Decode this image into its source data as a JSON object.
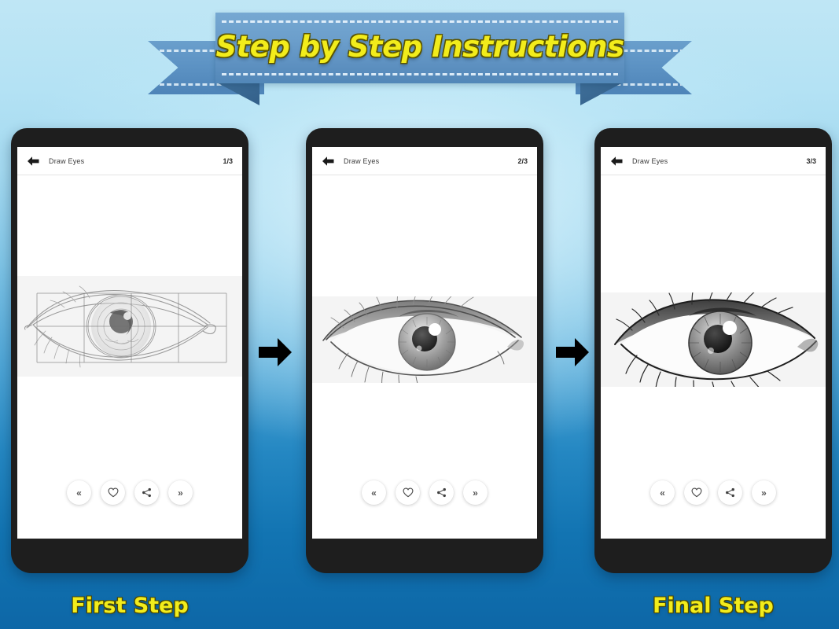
{
  "banner": {
    "title": "Step by Step Instructions",
    "text_color": "#f2ec1b",
    "ribbon_color": "#6b9ecb"
  },
  "background": {
    "top_color": "#bfe6f5",
    "bottom_color": "#0d67a7"
  },
  "phones": [
    {
      "header": {
        "back_icon": "arrow-left-icon",
        "title": "Draw Eyes",
        "counter": "1/3"
      },
      "artwork": {
        "name": "eye-sketch-step-1",
        "description": "Light pencil outline of an eye with construction grid overlay",
        "grid": true,
        "shading": "outline"
      },
      "controls": [
        {
          "name": "previous-button",
          "icon": "chevron-double-left-icon",
          "glyph": "«"
        },
        {
          "name": "favorite-button",
          "icon": "heart-icon",
          "glyph": ""
        },
        {
          "name": "share-button",
          "icon": "share-icon",
          "glyph": ""
        },
        {
          "name": "next-button",
          "icon": "chevron-double-right-icon",
          "glyph": "»"
        }
      ],
      "caption": "First Step"
    },
    {
      "header": {
        "back_icon": "arrow-left-icon",
        "title": "Draw Eyes",
        "counter": "2/3"
      },
      "artwork": {
        "name": "eye-sketch-step-2",
        "description": "Shaded pencil drawing of an eye with iris detail and lashes",
        "grid": false,
        "shading": "medium"
      },
      "controls": [
        {
          "name": "previous-button",
          "icon": "chevron-double-left-icon",
          "glyph": "«"
        },
        {
          "name": "favorite-button",
          "icon": "heart-icon",
          "glyph": ""
        },
        {
          "name": "share-button",
          "icon": "share-icon",
          "glyph": ""
        },
        {
          "name": "next-button",
          "icon": "chevron-double-right-icon",
          "glyph": "»"
        }
      ],
      "caption": ""
    },
    {
      "header": {
        "back_icon": "arrow-left-icon",
        "title": "Draw Eyes",
        "counter": "3/3"
      },
      "artwork": {
        "name": "eye-sketch-step-3",
        "description": "Fully rendered pencil drawing of an eye with dark lashes and detailed iris",
        "grid": false,
        "shading": "full"
      },
      "controls": [
        {
          "name": "previous-button",
          "icon": "chevron-double-left-icon",
          "glyph": "«"
        },
        {
          "name": "favorite-button",
          "icon": "heart-icon",
          "glyph": ""
        },
        {
          "name": "share-button",
          "icon": "share-icon",
          "glyph": ""
        },
        {
          "name": "next-button",
          "icon": "chevron-double-right-icon",
          "glyph": "»"
        }
      ],
      "caption": "Final Step"
    }
  ],
  "flow_arrows": [
    {
      "name": "flow-arrow-1",
      "direction": "right"
    },
    {
      "name": "flow-arrow-2",
      "direction": "right"
    }
  ]
}
